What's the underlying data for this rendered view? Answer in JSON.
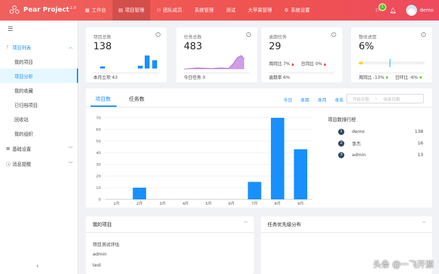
{
  "header": {
    "app_name": "Pear Project",
    "version": "2.0",
    "nav": [
      {
        "label": "工作台",
        "icon": "home-icon",
        "glyph": "▦",
        "active": false
      },
      {
        "label": "项目管理",
        "icon": "project-icon",
        "glyph": "▤",
        "active": true
      },
      {
        "label": "团队成员",
        "icon": "team-icon",
        "glyph": "⚇",
        "active": false
      },
      {
        "label": "系统管理",
        "icon": "",
        "glyph": "",
        "active": false
      },
      {
        "label": "测试",
        "icon": "",
        "glyph": "",
        "active": false
      },
      {
        "label": "大苹果管理",
        "icon": "",
        "glyph": "",
        "active": false
      },
      {
        "label": "系统设置",
        "icon": "settings-icon",
        "glyph": "⚙",
        "active": false
      }
    ],
    "task_badge": "1",
    "username": "demo"
  },
  "sidebar": {
    "groups": [
      {
        "label": "项目列表",
        "open": true
      },
      {
        "label": "基础设置",
        "open": false
      },
      {
        "label": "消息提醒",
        "open": false
      }
    ],
    "items": [
      "我的项目",
      "项目分析",
      "我的收藏",
      "已归档项目",
      "回收站",
      "我的组织"
    ],
    "selected_index": 1
  },
  "stats": [
    {
      "label": "项目总数",
      "value": "138",
      "footer": "本月立项 43"
    },
    {
      "label": "任务总数",
      "value": "483",
      "footer": "今日任务 0"
    },
    {
      "label": "逾期任务",
      "value": "29",
      "week_label": "周同比",
      "week_value": "7%",
      "day_label": "日同比",
      "day_value": "0%",
      "footer": "逾期率 6%"
    },
    {
      "label": "整体进度",
      "value": "6%",
      "progress": 0.06,
      "week_label": "周同比",
      "week_value": "-13%",
      "day_label": "日环比",
      "day_value": "-6%"
    }
  ],
  "main": {
    "tabs": [
      "项目数",
      "任务数"
    ],
    "active_tab": 0,
    "ranges": [
      "今日",
      "本周",
      "本月",
      "本年"
    ],
    "date_start": "开始日期",
    "date_sep": "~",
    "date_end": "结束日期",
    "rank_title": "项目数排行榜",
    "ranking": [
      {
        "rank": "1",
        "name": "demo",
        "value": "138"
      },
      {
        "rank": "2",
        "name": "李杰",
        "value": "16"
      },
      {
        "rank": "3",
        "name": "admin",
        "value": "13"
      }
    ]
  },
  "chart_data": {
    "type": "bar",
    "categories": [
      "1月",
      "2月",
      "3月",
      "4月",
      "5月",
      "6月",
      "7月",
      "8月",
      "9月"
    ],
    "values": [
      0,
      10,
      0,
      0,
      0,
      0,
      15,
      70,
      43
    ],
    "ylim": [
      0,
      70
    ],
    "yticks": [
      0,
      10,
      20,
      30,
      40,
      50,
      60,
      70
    ],
    "grid": true,
    "color": "#1890ff"
  },
  "bottom": {
    "projects_title": "我的项目",
    "projects": [
      "项目测试评估",
      "admin",
      "test"
    ],
    "priority_title": "任务优先级分布"
  },
  "watermark": "头条 @一飞开源",
  "colors": {
    "header": "#f0615e",
    "accent": "#1890ff",
    "sidebar_selected": "#e6f7ff"
  }
}
